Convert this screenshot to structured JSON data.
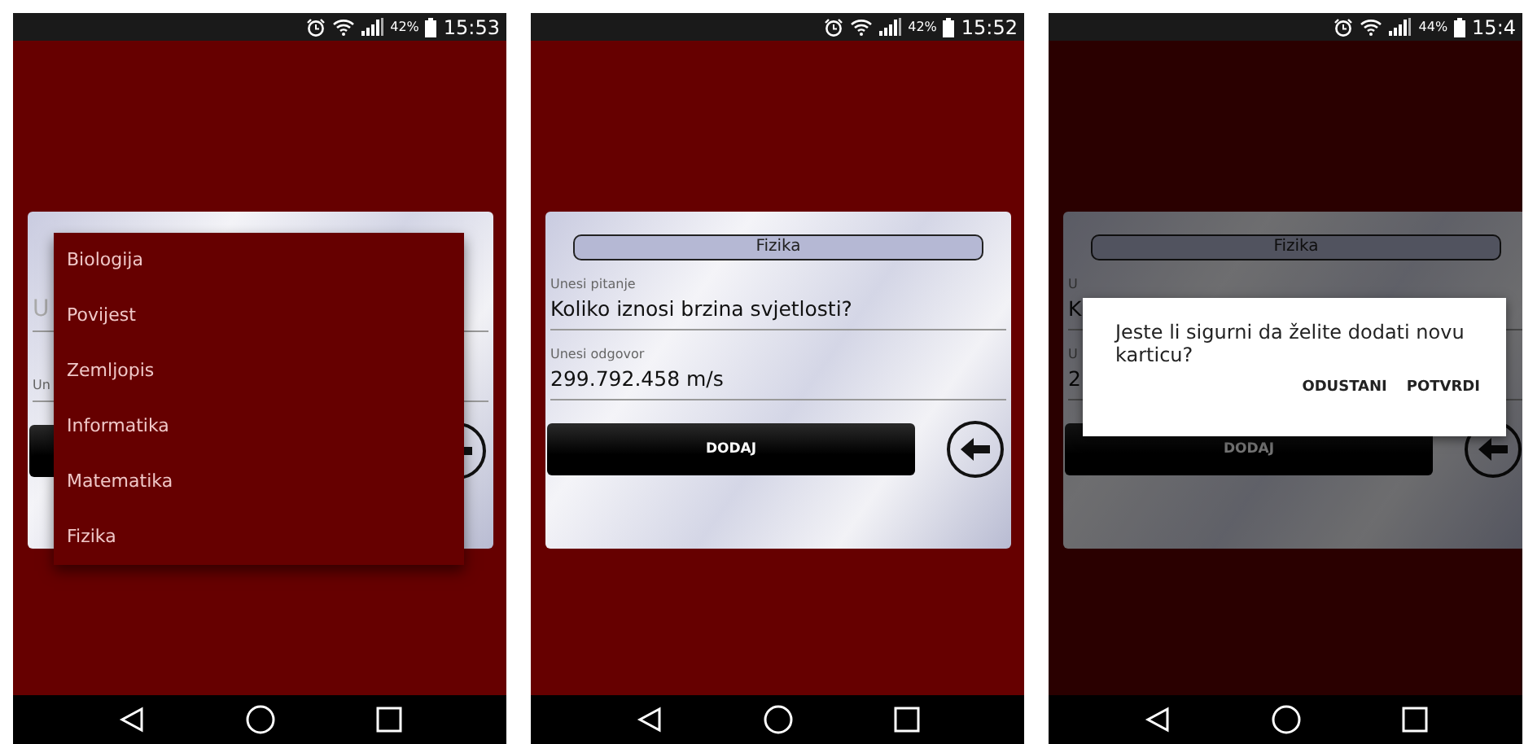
{
  "phones": [
    {
      "kind": "dropdown",
      "dimmed": false,
      "status": {
        "battery": "42%",
        "time": "15:53"
      },
      "card": {
        "fields": [
          {
            "placeholder": "U"
          },
          {
            "label": "Un"
          }
        ]
      },
      "menu": {
        "items": [
          "Biologija",
          "Povijest",
          "Zemljopis",
          "Informatika",
          "Matematika",
          "Fizika"
        ]
      }
    },
    {
      "kind": "form",
      "dimmed": false,
      "status": {
        "battery": "42%",
        "time": "15:52"
      },
      "card": {
        "category": "Fizika",
        "fields": [
          {
            "label": "Unesi pitanje",
            "value": "Koliko iznosi brzina svjetlosti?"
          },
          {
            "label": "Unesi odgovor",
            "value": "299.792.458 m/s"
          }
        ],
        "button": "DODAJ"
      }
    },
    {
      "kind": "confirm",
      "dimmed": true,
      "status": {
        "battery": "44%",
        "time": "15:4"
      },
      "card": {
        "category": "Fizika",
        "fields": [
          {
            "label": "U",
            "value": "K"
          },
          {
            "label": "U",
            "value": "2"
          }
        ],
        "button": "DODAJ"
      },
      "dialog": {
        "message": "Jeste li sigurni da želite dodati novu karticu?",
        "buttons": [
          "ODUSTANI",
          "POTVRDI"
        ]
      }
    }
  ]
}
